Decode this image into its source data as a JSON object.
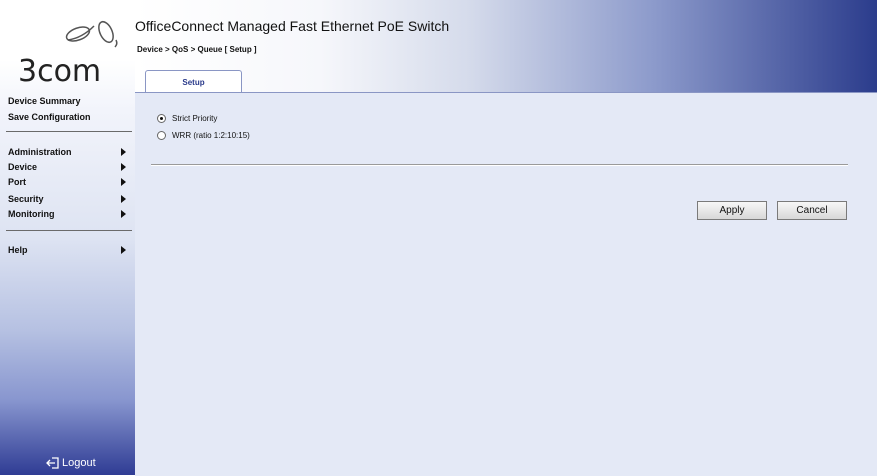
{
  "brand": {
    "logo_text": "3com"
  },
  "sidebar": {
    "links": [
      "Device Summary",
      "Save Configuration"
    ],
    "menu": [
      "Administration",
      "Device",
      "Port",
      "Security",
      "Monitoring"
    ],
    "help": "Help",
    "logout": "Logout"
  },
  "header": {
    "title": "OfficeConnect Managed Fast Ethernet PoE Switch",
    "breadcrumb": "Device > QoS > Queue [ Setup ]",
    "tab": "Setup"
  },
  "form": {
    "options": [
      {
        "label": "Strict Priority",
        "checked": true
      },
      {
        "label": "WRR (ratio 1:2:10:15)",
        "checked": false
      }
    ],
    "apply_label": "Apply",
    "cancel_label": "Cancel"
  }
}
